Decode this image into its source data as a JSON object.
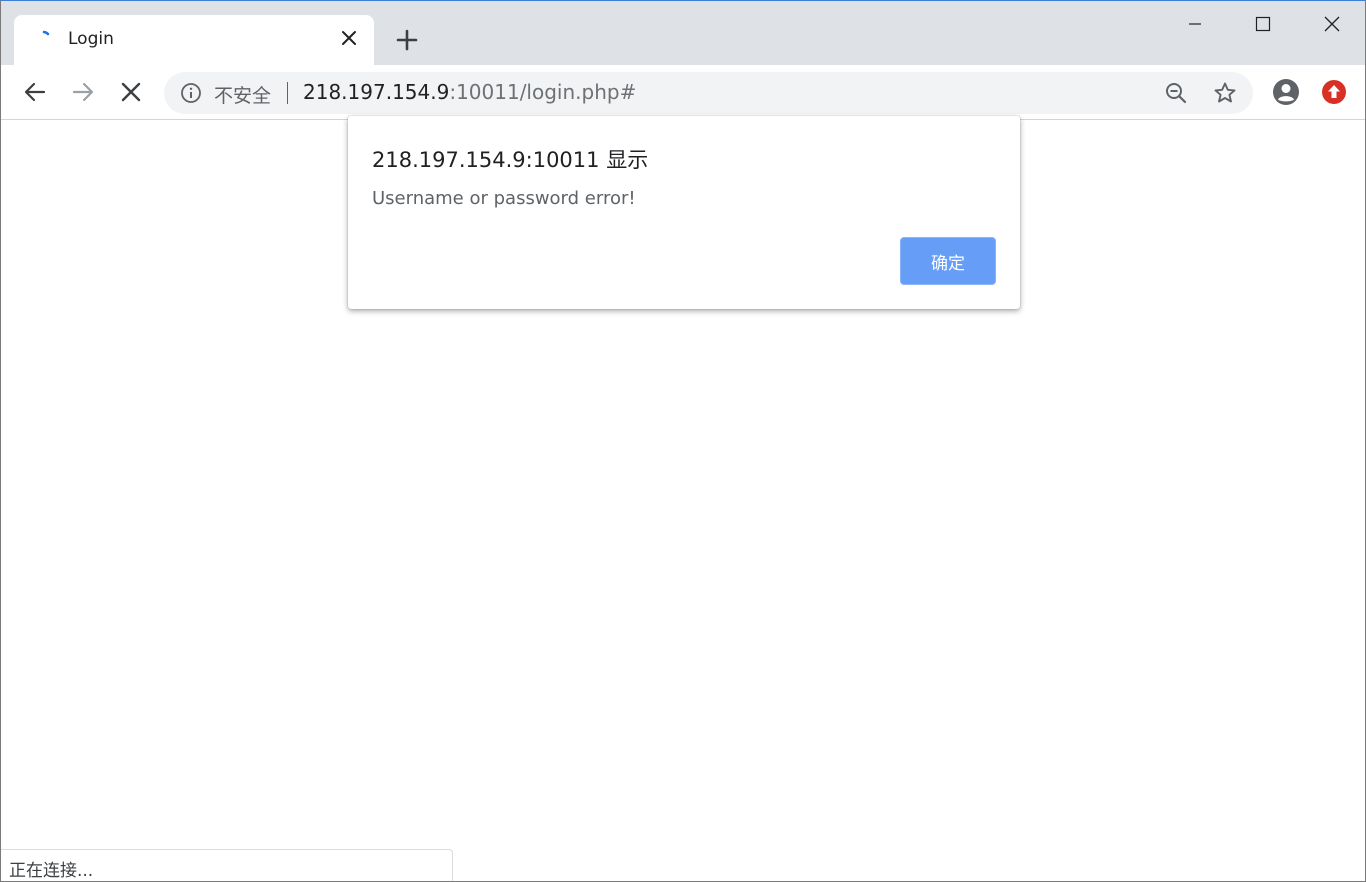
{
  "tab": {
    "title": "Login",
    "loading_icon": "loading-spinner-icon",
    "close_icon": "close-icon"
  },
  "new_tab_icon": "plus-icon",
  "window_controls": {
    "minimize_icon": "minimize-icon",
    "maximize_icon": "maximize-icon",
    "close_icon": "close-icon"
  },
  "toolbar": {
    "back_icon": "arrow-left-icon",
    "forward_icon": "arrow-right-icon",
    "stop_icon": "stop-loading-icon",
    "profile_icon": "account-circle-icon",
    "update_icon": "update-arrow-icon"
  },
  "omnibox": {
    "info_icon": "info-icon",
    "security_label": "不安全",
    "url_host": "218.197.154.9",
    "url_rest": ":10011/login.php#",
    "zoom_icon": "zoom-out-icon",
    "bookmark_icon": "star-icon"
  },
  "dialog": {
    "title": "218.197.154.9:10011 显示",
    "message": "Username or password error!",
    "ok_label": "确定"
  },
  "status": {
    "text": "正在连接..."
  },
  "colors": {
    "tabstrip_bg": "#dee1e6",
    "omnibox_bg": "#f1f3f4",
    "dialog_button": "#669df6",
    "spinner": "#1a73e8",
    "update_badge": "#d93025"
  }
}
